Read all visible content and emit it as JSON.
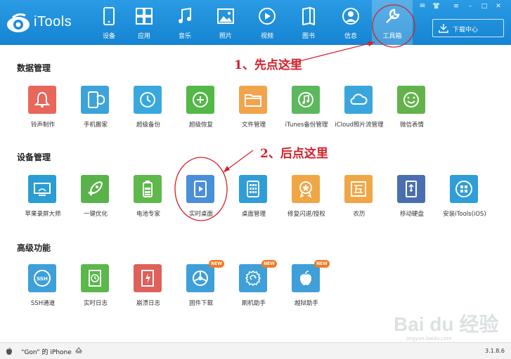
{
  "app": {
    "logo_text": "iTools",
    "version": "3.1.8.6"
  },
  "nav": {
    "items": [
      {
        "label": "设备",
        "icon": "device-icon"
      },
      {
        "label": "应用",
        "icon": "apps-icon"
      },
      {
        "label": "音乐",
        "icon": "music-icon"
      },
      {
        "label": "照片",
        "icon": "photo-icon"
      },
      {
        "label": "视频",
        "icon": "video-icon"
      },
      {
        "label": "图书",
        "icon": "book-icon"
      },
      {
        "label": "信息",
        "icon": "user-icon"
      },
      {
        "label": "工具箱",
        "icon": "wrench-icon",
        "active": true
      }
    ],
    "download_center": "下载中心"
  },
  "sections": {
    "data_management": {
      "title": "数据管理",
      "tiles": [
        {
          "label": "铃声制作",
          "color": "#e8665a",
          "icon": "bell-icon"
        },
        {
          "label": "手机搬家",
          "color": "#3ea3d9",
          "icon": "phone-transfer-icon"
        },
        {
          "label": "超级备份",
          "color": "#39a8df",
          "icon": "backup-clock-icon"
        },
        {
          "label": "超级恢复",
          "color": "#54b847",
          "icon": "restore-icon"
        },
        {
          "label": "文件管理",
          "color": "#f2a44c",
          "icon": "folder-icon"
        },
        {
          "label": "iTunes备份管理",
          "color": "#5cb85c",
          "icon": "music-note-icon"
        },
        {
          "label": "iCloud照片流管理",
          "color": "#3aa6dc",
          "icon": "cloud-icon"
        },
        {
          "label": "微信表情",
          "color": "#62b34b",
          "icon": "smiley-icon"
        }
      ]
    },
    "device_management": {
      "title": "设备管理",
      "tiles": [
        {
          "label": "苹果录屏大师",
          "color": "#2a9ed3",
          "icon": "screen-record-icon"
        },
        {
          "label": "一键优化",
          "color": "#59b34a",
          "icon": "rocket-icon"
        },
        {
          "label": "电池专家",
          "color": "#5fb84b",
          "icon": "battery-icon"
        },
        {
          "label": "实时桌面",
          "color": "#4a8fd9",
          "icon": "play-icon"
        },
        {
          "label": "桌面管理",
          "color": "#2f9ed8",
          "icon": "grid-icon"
        },
        {
          "label": "修复闪退/授权",
          "color": "#f0a645",
          "icon": "badge-star-icon"
        },
        {
          "label": "农历",
          "color": "#f0a645",
          "icon": "calendar-five-icon"
        },
        {
          "label": "移动硬盘",
          "color": "#4a6fb0",
          "icon": "usb-drive-icon"
        },
        {
          "label": "安装iTools(iOS)",
          "color": "#2f9ed8",
          "icon": "itools-install-icon"
        }
      ]
    },
    "advanced": {
      "title": "高级功能",
      "tiles": [
        {
          "label": "SSH通道",
          "color": "#3e9fd9",
          "icon": "ssh-icon"
        },
        {
          "label": "实时日志",
          "color": "#5bb84b",
          "icon": "live-log-icon"
        },
        {
          "label": "崩溃日志",
          "color": "#e0605a",
          "icon": "crash-log-icon"
        },
        {
          "label": "固件下载",
          "color": "#3e9fd9",
          "icon": "firmware-icon",
          "badge": "NEW"
        },
        {
          "label": "刷机助手",
          "color": "#3e9fd9",
          "icon": "flash-icon",
          "badge": "NEW"
        },
        {
          "label": "越狱助手",
          "color": "#3e9fd9",
          "icon": "apple-icon",
          "badge": "NEW"
        }
      ]
    }
  },
  "annotations": {
    "step1": "1、先点这里",
    "step2": "2、后点这里"
  },
  "status": {
    "device_name": "“Gon” 的 iPhone"
  },
  "watermark": {
    "brand": "Bai du 经验",
    "url": "jingyan.baidu.com"
  },
  "colors": {
    "topbar": "#1a8ad8",
    "annotation": "#d2212a"
  }
}
